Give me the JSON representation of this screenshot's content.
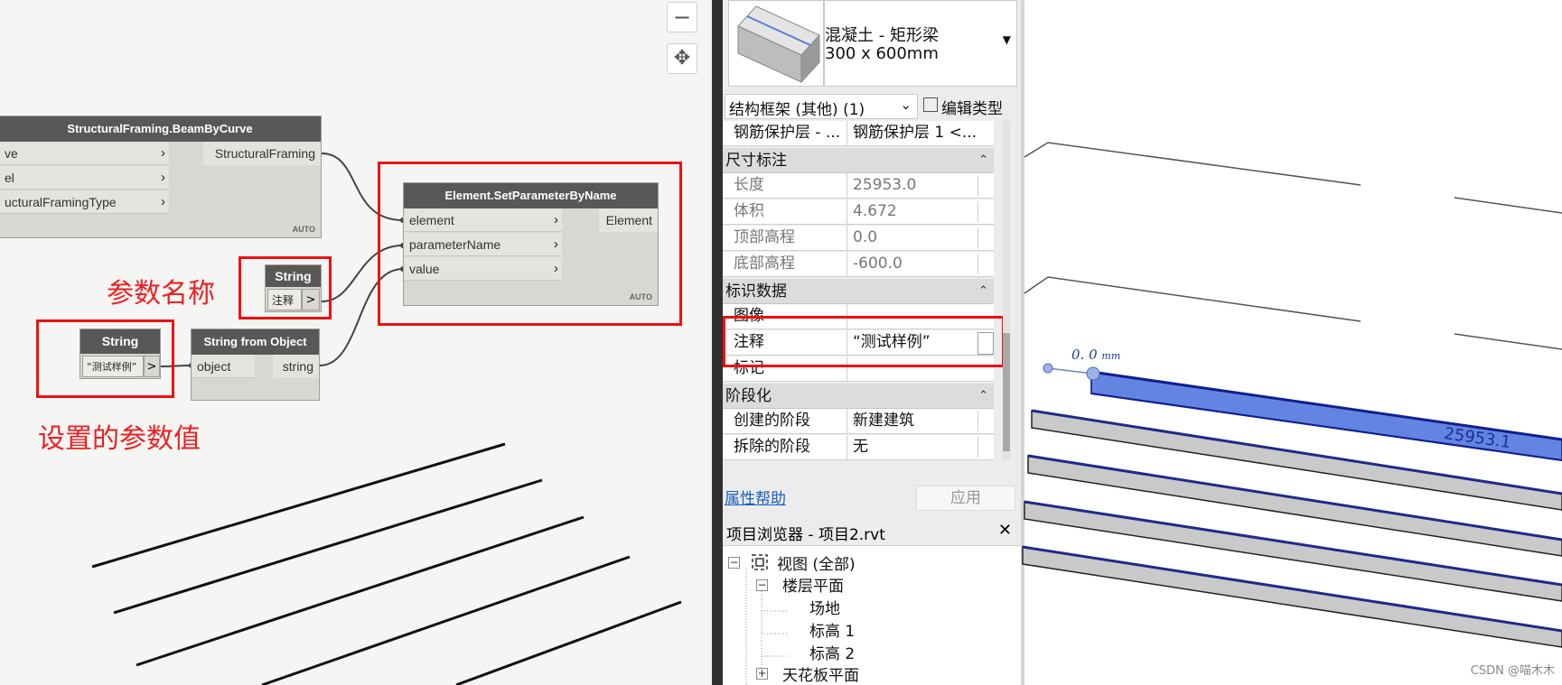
{
  "dynamo": {
    "node_beam": {
      "title": "StructuralFraming.BeamByCurve",
      "inputs": [
        "ve",
        "el",
        "ucturalFramingType"
      ],
      "output": "StructuralFraming",
      "auto": "AUTO"
    },
    "node_set_param": {
      "title": "Element.SetParameterByName",
      "inputs": [
        "element",
        "parameterName",
        "value"
      ],
      "output": "Element",
      "auto": "AUTO"
    },
    "node_string_name": {
      "title": "String",
      "value": "注释",
      "button": ">"
    },
    "node_string_value": {
      "title": "String",
      "value": "“测试样例”",
      "button": ">"
    },
    "node_string_from_object": {
      "title": "String from Object",
      "input": "object",
      "output": "string"
    },
    "annotations": {
      "param_name": "参数名称",
      "param_value": "设置的参数值"
    },
    "zoom_out": "−",
    "pan": "✥"
  },
  "properties": {
    "type_line1": "混凝土 - 矩形梁",
    "type_line2": "300 x 600mm",
    "category_selector": "结构框架 (其他) (1)",
    "edit_type": "编辑类型",
    "rebar_cover": {
      "name": "钢筋保护层 - ...",
      "value": "钢筋保护层 1 <..."
    },
    "group_dimensions": "尺寸标注",
    "dimensions": [
      {
        "name": "长度",
        "value": "25953.0"
      },
      {
        "name": "体积",
        "value": "4.672"
      },
      {
        "name": "顶部高程",
        "value": "0.0"
      },
      {
        "name": "底部高程",
        "value": "-600.0"
      }
    ],
    "group_identity": "标识数据",
    "identity": [
      {
        "name": "图像",
        "value": ""
      },
      {
        "name": "注释",
        "value": "“测试样例”"
      },
      {
        "name": "标记",
        "value": ""
      }
    ],
    "group_phasing": "阶段化",
    "phasing": [
      {
        "name": "创建的阶段",
        "value": "新建建筑"
      },
      {
        "name": "拆除的阶段",
        "value": "无"
      }
    ],
    "help_link": "属性帮助",
    "apply": "应用"
  },
  "browser": {
    "title": "项目浏览器 - 项目2.rvt",
    "close": "✕",
    "views": "视图 (全部)",
    "floor_plans": "楼层平面",
    "site": "场地",
    "level1": "标高 1",
    "level2": "标高 2",
    "ceiling_plans": "天花板平面"
  },
  "view3d": {
    "offset_label": "0. 0",
    "offset_unit": "mm",
    "length_label": "25953.1",
    "watermark": "CSDN @喵木木"
  },
  "colors": {
    "annotation_red": "#ee1111",
    "node_header": "#595856",
    "beam_selected": "#4a6fd8",
    "beam_concrete": "#c8c8c8"
  }
}
